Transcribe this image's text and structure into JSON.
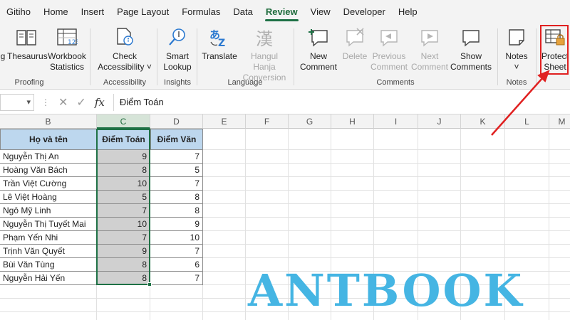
{
  "menu": {
    "items": [
      {
        "label": "Gitiho",
        "active": false
      },
      {
        "label": "Home",
        "active": false
      },
      {
        "label": "Insert",
        "active": false
      },
      {
        "label": "Page Layout",
        "active": false
      },
      {
        "label": "Formulas",
        "active": false
      },
      {
        "label": "Data",
        "active": false
      },
      {
        "label": "Review",
        "active": true
      },
      {
        "label": "View",
        "active": false
      },
      {
        "label": "Developer",
        "active": false
      },
      {
        "label": "Help",
        "active": false
      }
    ]
  },
  "ribbon": {
    "cut_label": "g",
    "thesaurus": "Thesaurus",
    "workbook_statistics": "Workbook\nStatistics",
    "group_proofing": "Proofing",
    "check_accessibility": "Check\nAccessibility ˅",
    "group_accessibility": "Accessibility",
    "smart_lookup": "Smart\nLookup",
    "group_insights": "Insights",
    "translate": "Translate",
    "hangul_hanja": "Hangul Hanja\nConversion",
    "group_language": "Language",
    "new_comment": "New\nComment",
    "delete": "Delete",
    "previous_comment": "Previous\nComment",
    "next_comment": "Next\nComment",
    "show_comments": "Show\nComments",
    "group_comments": "Comments",
    "notes": "Notes\n˅",
    "group_notes": "Notes",
    "protect_sheet": "Protect\nSheet"
  },
  "formula_bar": {
    "fx": "fx",
    "value": "Điểm Toán"
  },
  "columns": [
    "B",
    "C",
    "D",
    "E",
    "F",
    "G",
    "H",
    "I",
    "J",
    "K",
    "L",
    "M"
  ],
  "table": {
    "headers": [
      "Họ và tên",
      "Điểm Toán",
      "Điểm Văn"
    ],
    "rows": [
      {
        "name": "Nguyễn Thị An",
        "toan": "9",
        "van": "7"
      },
      {
        "name": "Hoàng Văn Bách",
        "toan": "8",
        "van": "5"
      },
      {
        "name": "Trần Việt Cường",
        "toan": "10",
        "van": "7"
      },
      {
        "name": "Lê Việt Hoàng",
        "toan": "5",
        "van": "8"
      },
      {
        "name": "Ngô Mỹ Linh",
        "toan": "7",
        "van": "8"
      },
      {
        "name": "Nguyễn Thị Tuyết Mai",
        "toan": "10",
        "van": "9"
      },
      {
        "name": "Phạm Yến Nhi",
        "toan": "7",
        "van": "10"
      },
      {
        "name": "Trịnh Văn Quyết",
        "toan": "9",
        "van": "7"
      },
      {
        "name": "Bùi Văn Tùng",
        "toan": "8",
        "van": "6"
      },
      {
        "name": "Nguyễn Hải Yến",
        "toan": "8",
        "van": "7"
      }
    ]
  },
  "watermark": "ANTBOOK",
  "colors": {
    "accent_green": "#1e7145",
    "header_fill": "#bdd7ee",
    "selection_fill": "#d0d0d0",
    "annotation_red": "#e02020",
    "watermark": "#45b5e3"
  }
}
